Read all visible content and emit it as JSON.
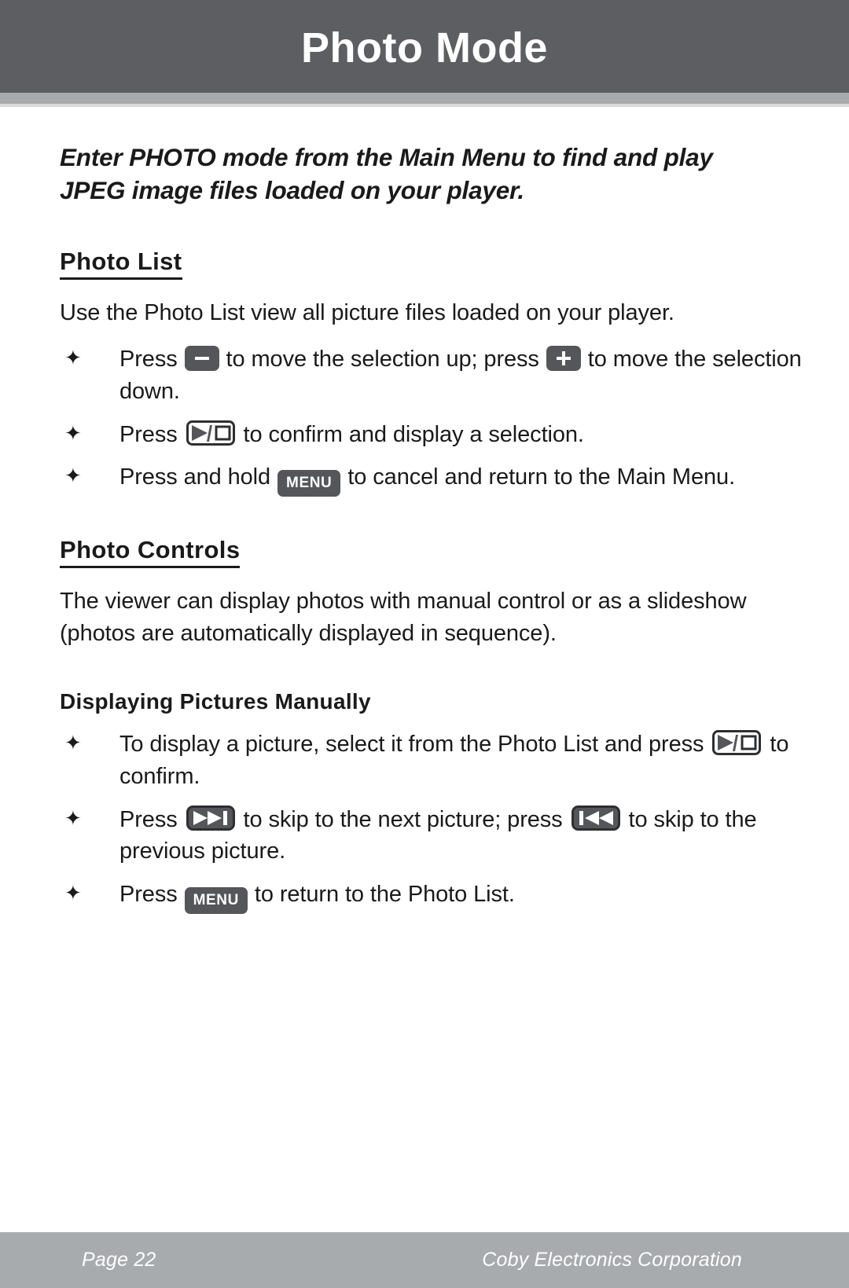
{
  "header": {
    "title": "Photo Mode"
  },
  "intro": "Enter PHOTO mode from the Main Menu to find and play JPEG image files loaded on your player.",
  "sections": {
    "photo_list": {
      "heading": "Photo List",
      "body": "Use the Photo List view all picture files loaded on your player.",
      "bullets": [
        {
          "marker": "✦",
          "parts": [
            {
              "type": "text",
              "value": "Press "
            },
            {
              "type": "key",
              "icon": "minus-button-icon",
              "label": "–"
            },
            {
              "type": "text",
              "value": " to move the selection up; press "
            },
            {
              "type": "key",
              "icon": "plus-button-icon",
              "label": "+"
            },
            {
              "type": "text",
              "value": " to move the selection down."
            }
          ]
        },
        {
          "marker": "✦",
          "parts": [
            {
              "type": "text",
              "value": "Press "
            },
            {
              "type": "key",
              "icon": "play-pause-button-icon",
              "label": "▶/□"
            },
            {
              "type": "text",
              "value": " to confirm and display a selection."
            }
          ]
        },
        {
          "marker": "✦",
          "parts": [
            {
              "type": "text",
              "value": "Press and hold "
            },
            {
              "type": "key",
              "icon": "menu-button-icon",
              "label": "MENU"
            },
            {
              "type": "text",
              "value": " to cancel and return to the Main Menu."
            }
          ]
        }
      ]
    },
    "photo_controls": {
      "heading": "Photo Controls",
      "body": "The viewer can display photos with manual control or as a slideshow (photos are automatically displayed in sequence).",
      "sub_heading": "Displaying Pictures Manually",
      "bullets": [
        {
          "marker": "✦",
          "parts": [
            {
              "type": "text",
              "value": "To display a picture, select it from the Photo List and press "
            },
            {
              "type": "key",
              "icon": "play-pause-button-icon",
              "label": "▶/□"
            },
            {
              "type": "text",
              "value": " to confirm."
            }
          ]
        },
        {
          "marker": "✦",
          "parts": [
            {
              "type": "text",
              "value": "Press "
            },
            {
              "type": "key",
              "icon": "skip-next-button-icon",
              "label": "▶▶|"
            },
            {
              "type": "text",
              "value": " to skip to the next picture; press "
            },
            {
              "type": "key",
              "icon": "skip-previous-button-icon",
              "label": "|◀◀"
            },
            {
              "type": "text",
              "value": " to skip to the previous picture."
            }
          ]
        },
        {
          "marker": "✦",
          "parts": [
            {
              "type": "text",
              "value": "Press "
            },
            {
              "type": "key",
              "icon": "menu-button-icon",
              "label": "MENU"
            },
            {
              "type": "text",
              "value": " to return to the Photo List."
            }
          ]
        }
      ]
    }
  },
  "footer": {
    "page_label": "Page 22",
    "company": "Coby Electronics Corporation"
  },
  "colors": {
    "header_band": "#5c5e61",
    "divider_band": "#a7abae",
    "footer_band": "#a7abae",
    "key_fill": "#55565a",
    "text": "#1a1a1a"
  }
}
